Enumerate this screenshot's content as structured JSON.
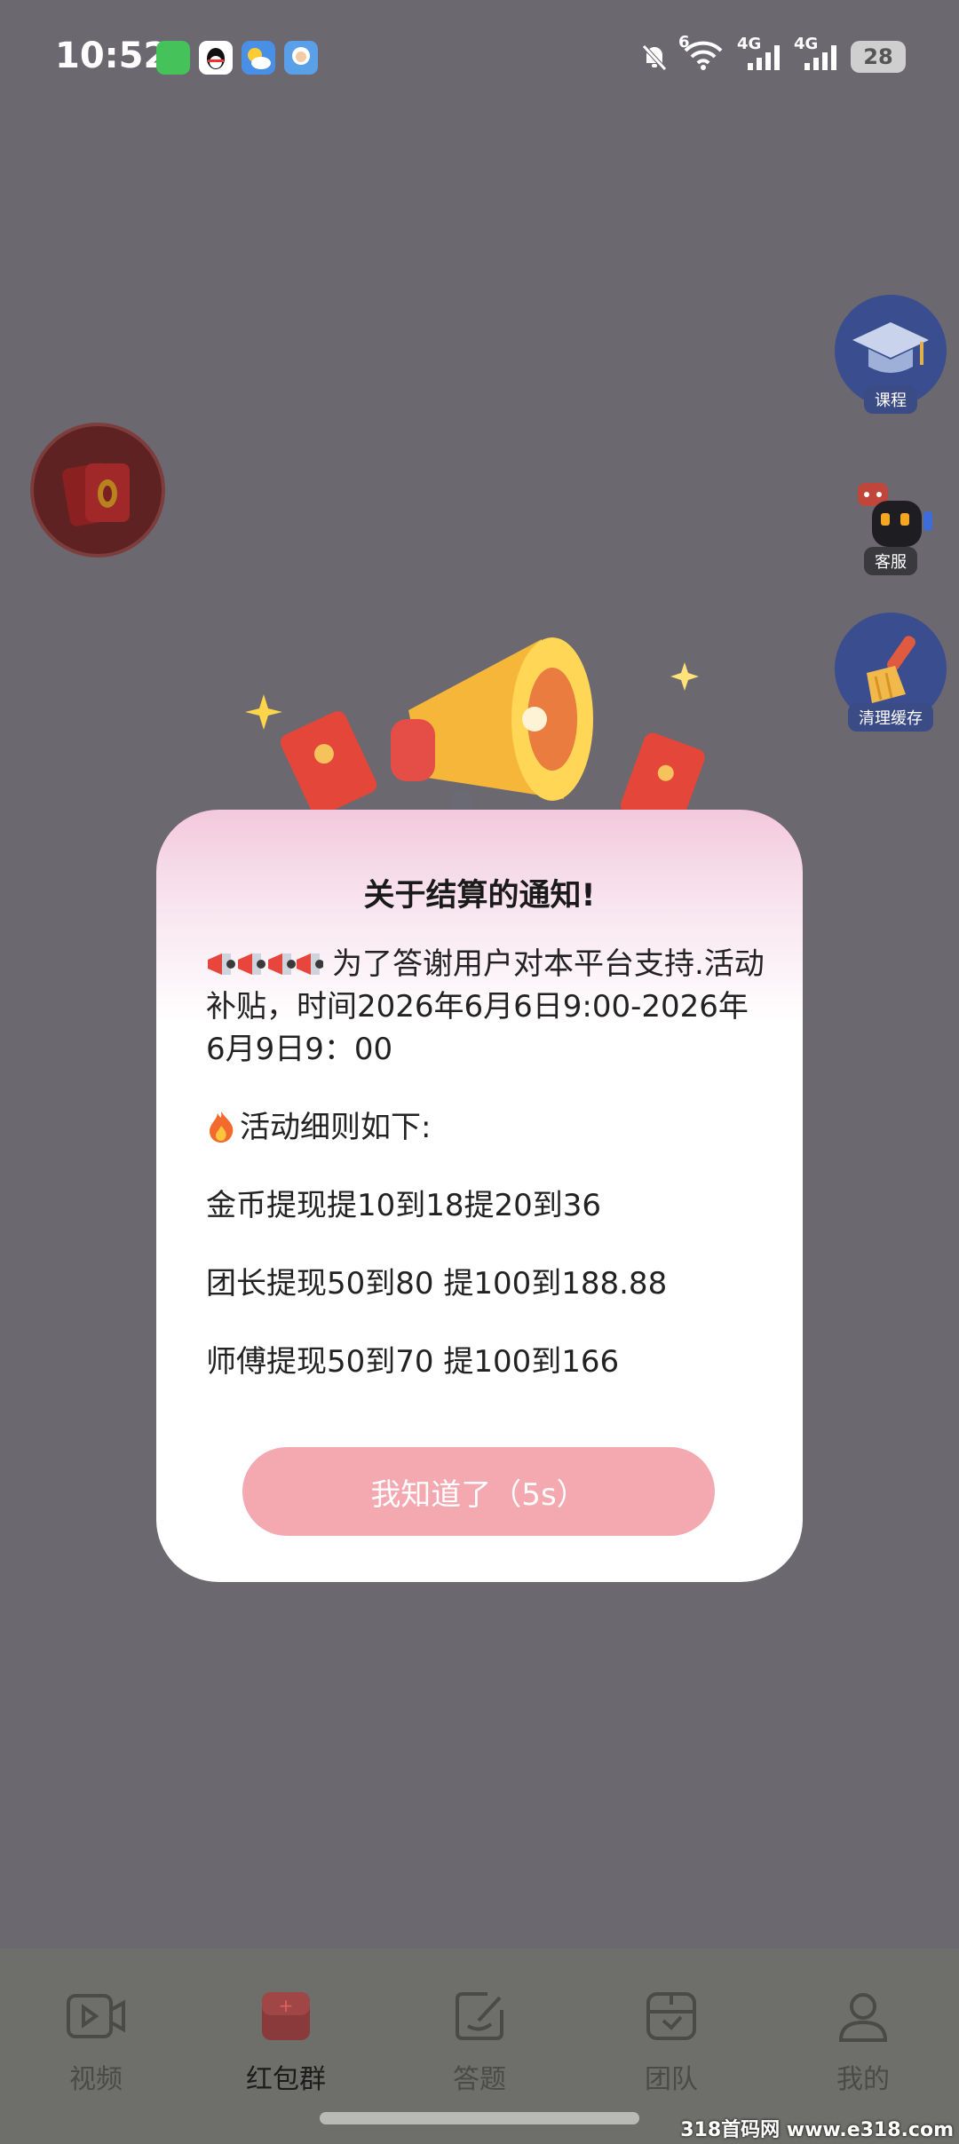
{
  "status_bar": {
    "time": "10:52",
    "net_left": "4G",
    "net_right": "4G",
    "wifi_tag": "6",
    "battery": "28"
  },
  "side_actions": {
    "course": "课程",
    "service": "客服",
    "clear_cache": "清理缓存"
  },
  "dialog": {
    "title": "关于结算的通知!",
    "intro": "为了答谢用户对本平台支持.活动补贴，时间2026年6月6日9:00-2026年6月9日9：00",
    "rules_heading": "活动细则如下:",
    "rules": [
      "金币提现提10到18提20到36",
      "团长提现50到80 提100到188.88",
      "师傅提现50到70 提100到166"
    ],
    "button_label": "我知道了（5s）"
  },
  "bottom_nav": {
    "items": [
      {
        "label": "视频"
      },
      {
        "label": "红包群"
      },
      {
        "label": "答题"
      },
      {
        "label": "团队"
      },
      {
        "label": "我的"
      }
    ]
  },
  "watermark": "318首码网 www.e318.com"
}
